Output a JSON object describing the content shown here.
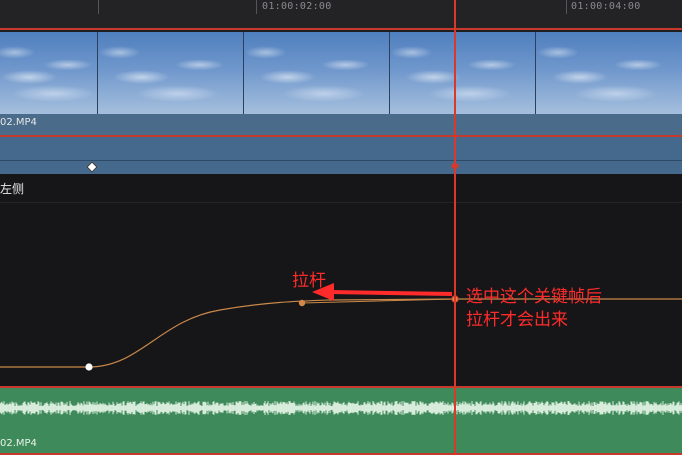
{
  "ruler": {
    "timecodes": [
      "01:00:02:00",
      "01:00:04:00"
    ]
  },
  "video_track": {
    "clip_label": "02.MP4"
  },
  "curve_panel": {
    "label": "左侧"
  },
  "audio_track": {
    "clip_label": "02.MP4"
  },
  "annotations": {
    "handle_label": "拉杆",
    "note_line1": "选中这个关键帧后",
    "note_line2": "拉杆才会出来"
  },
  "colors": {
    "playhead": "#d8392b",
    "track_border": "#c53a2c",
    "video_clip": "#4a6b8a",
    "keyframe_lane": "#44698c",
    "audio_clip": "#3f8a5a",
    "curve": "#c8884a",
    "annotation": "#ff2b2b"
  }
}
